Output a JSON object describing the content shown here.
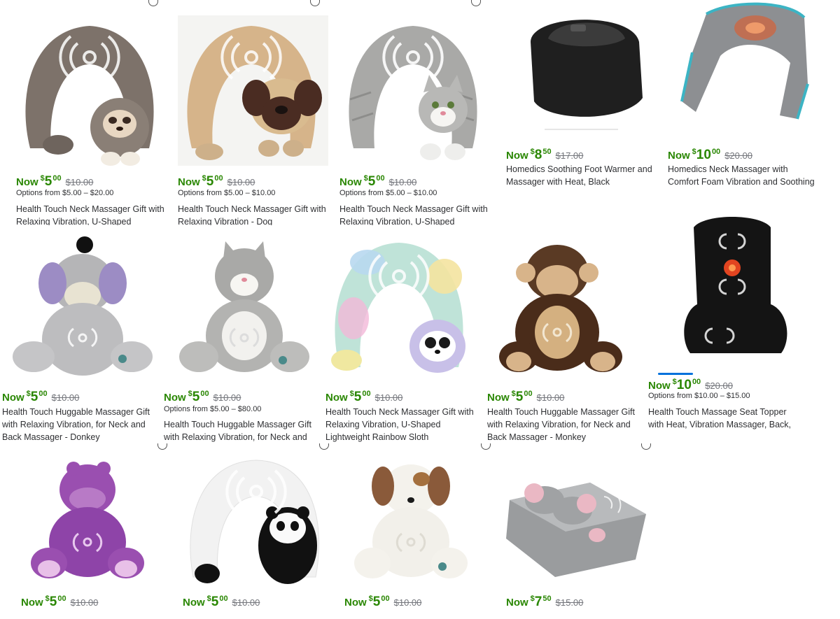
{
  "products": [
    {
      "now_label": "Now",
      "dollar": "$",
      "whole": "5",
      "cents": "00",
      "was": "$10.00",
      "options": "Options from $5.00 – $20.00",
      "title": "Health Touch Neck Massager Gift with Relaxing Vibration, U-Shaped",
      "image": "sloth-neck-pillow-grey"
    },
    {
      "now_label": "Now",
      "dollar": "$",
      "whole": "5",
      "cents": "00",
      "was": "$10.00",
      "options": "Options from $5.00 – $10.00",
      "title": "Health Touch Neck Massager Gift with Relaxing Vibration - Dog",
      "image": "pug-neck-pillow"
    },
    {
      "now_label": "Now",
      "dollar": "$",
      "whole": "5",
      "cents": "00",
      "was": "$10.00",
      "options": "Options from $5.00 – $10.00",
      "title": "Health Touch Neck Massager Gift with Relaxing Vibration, U-Shaped",
      "image": "cat-neck-pillow"
    },
    {
      "now_label": "Now",
      "dollar": "$",
      "whole": "8",
      "cents": "50",
      "was": "$17.00",
      "options": "",
      "title": "Homedics Soothing Foot Warmer and Massager with Heat, Black",
      "image": "foot-warmer-black"
    },
    {
      "now_label": "Now",
      "dollar": "$",
      "whole": "10",
      "cents": "00",
      "was": "$20.00",
      "options": "",
      "title": "Homedics Neck Massager with Comfort Foam Vibration and Soothing Heat",
      "image": "neck-massager-grey"
    },
    {
      "now_label": "Now",
      "dollar": "$",
      "whole": "5",
      "cents": "00",
      "was": "$10.00",
      "options": "",
      "title": "Health Touch Huggable Massager Gift with Relaxing Vibration, for Neck and Back Massager - Donkey",
      "image": "donkey-plush"
    },
    {
      "now_label": "Now",
      "dollar": "$",
      "whole": "5",
      "cents": "00",
      "was": "$10.00",
      "options": "Options from $5.00 – $80.00",
      "title": "Health Touch Huggable Massager Gift with Relaxing Vibration, for Neck and",
      "image": "cat-plush"
    },
    {
      "now_label": "Now",
      "dollar": "$",
      "whole": "5",
      "cents": "00",
      "was": "$10.00",
      "options": "",
      "title": "Health Touch Neck Massager Gift with Relaxing Vibration, U-Shaped Lightweight Rainbow Sloth",
      "image": "rainbow-sloth-pillow"
    },
    {
      "now_label": "Now",
      "dollar": "$",
      "whole": "5",
      "cents": "00",
      "was": "$10.00",
      "options": "",
      "title": "Health Touch Huggable Massager Gift with Relaxing Vibration, for Neck and Back Massager - Monkey",
      "image": "monkey-plush"
    },
    {
      "now_label": "Now",
      "dollar": "$",
      "whole": "10",
      "cents": "00",
      "was": "$20.00",
      "options": "Options from $10.00 – $15.00",
      "title": "Health Touch Massage Seat Topper with Heat, Vibration Massager, Back, Lumbar",
      "image": "seat-topper"
    },
    {
      "now_label": "Now",
      "dollar": "$",
      "whole": "5",
      "cents": "00",
      "was": "$10.00",
      "options": "",
      "title": "",
      "image": "hippo-plush"
    },
    {
      "now_label": "Now",
      "dollar": "$",
      "whole": "5",
      "cents": "00",
      "was": "$10.00",
      "options": "",
      "title": "",
      "image": "panda-neck-pillow"
    },
    {
      "now_label": "Now",
      "dollar": "$",
      "whole": "5",
      "cents": "00",
      "was": "$10.00",
      "options": "",
      "title": "",
      "image": "puppy-plush"
    },
    {
      "now_label": "Now",
      "dollar": "$",
      "whole": "7",
      "cents": "50",
      "was": "$15.00",
      "options": "",
      "title": "",
      "image": "elephant-foot-warmer"
    }
  ],
  "colors": {
    "price_green": "#2a8703",
    "strike_grey": "#74767c",
    "accent_blue": "#0071dc"
  }
}
